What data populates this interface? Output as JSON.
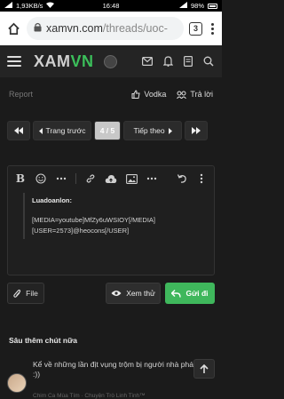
{
  "status_bar": {
    "speed": "1,93KB/s",
    "time": "16:48",
    "battery": "98%"
  },
  "browser": {
    "url_main": "xamvn.com",
    "url_path": "/threads/uoc-",
    "tab_count": "3"
  },
  "site": {
    "logo_left": "XAM",
    "logo_right": "VN"
  },
  "post": {
    "report_label": "Report",
    "like_label": "Vodka",
    "reply_label": "Trả lời"
  },
  "pager": {
    "prev_label": "Trang trước",
    "current": "4 / 5",
    "next_label": "Tiếp theo"
  },
  "editor": {
    "quote_author": "Luadoanlon:",
    "quote_line1": "[MEDIA=youtube]MfZy6uWSIOY[/MEDIA]",
    "quote_line2": "[USER=2573]@heocons[/USER]"
  },
  "actions": {
    "file_label": "File",
    "preview_label": "Xem thử",
    "send_label": "Gửi đi"
  },
  "related": {
    "title": "Sâu thêm chút nữa",
    "item_text": "Kể về những lần địt vụng trộm bị người nhà phát hiện :))",
    "item_meta": "Chim Ca Mùa Tím · Chuyện Trò Linh Tinh™"
  }
}
